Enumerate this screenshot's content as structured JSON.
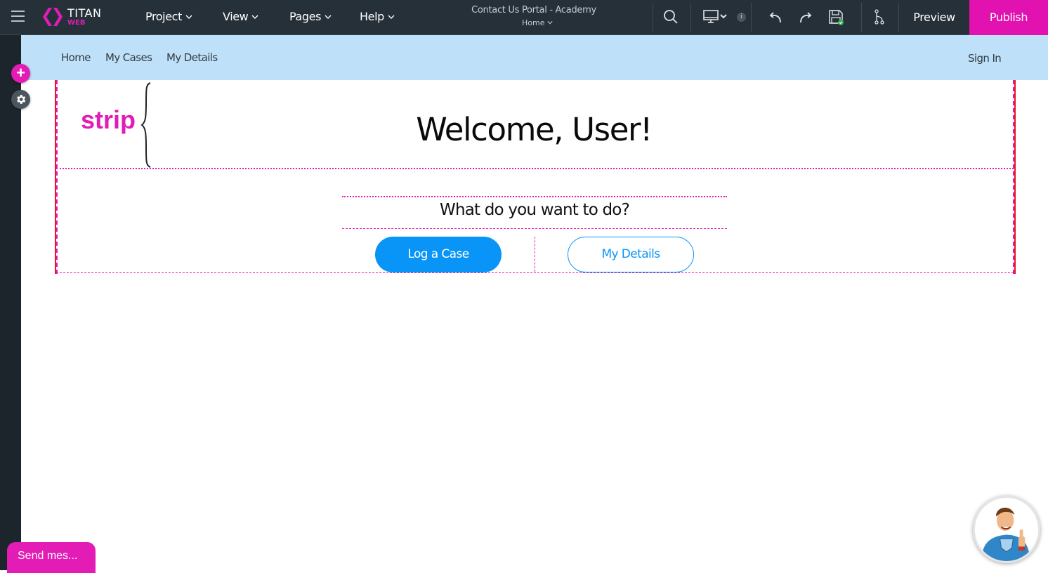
{
  "app": {
    "logo_title": "TITAN",
    "logo_subtitle": "WEB",
    "brand_color": "#e21cb5"
  },
  "topbar": {
    "menu": [
      {
        "label": "Project"
      },
      {
        "label": "View"
      },
      {
        "label": "Pages"
      },
      {
        "label": "Help"
      }
    ],
    "project_title": "Contact Us Portal - Academy",
    "current_page": "Home",
    "icons": [
      "search-icon",
      "desktop-icon",
      "info-icon",
      "undo-icon",
      "redo-icon",
      "save-icon",
      "branch-icon"
    ],
    "info_badge": "i",
    "preview_label": "Preview",
    "publish_label": "Publish"
  },
  "left_rail": {
    "add_label": "+"
  },
  "site_nav": {
    "links": [
      {
        "label": "Home"
      },
      {
        "label": "My Cases"
      },
      {
        "label": "My Details"
      }
    ],
    "sign_in": "Sign In"
  },
  "canvas": {
    "annotation": "strip",
    "welcome": "Welcome, User!",
    "question": "What do you want to do?",
    "primary_button": "Log a Case",
    "secondary_button": "My Details",
    "accent_color": "#0995f7"
  },
  "chat": {
    "label": "Send mes..."
  }
}
